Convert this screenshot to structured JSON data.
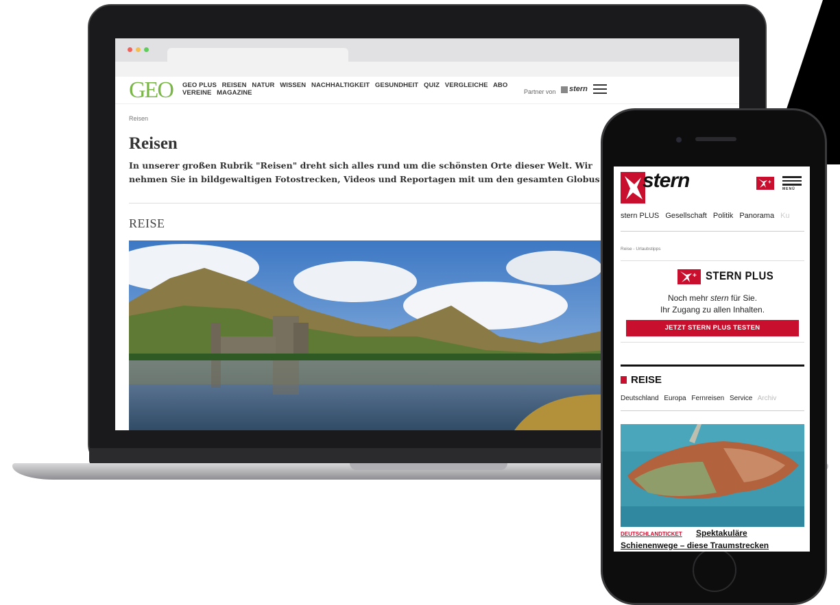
{
  "geo": {
    "logo": "GEO",
    "nav": [
      "GEO PLUS",
      "REISEN",
      "NATUR",
      "WISSEN",
      "NACHHALTIGKEIT",
      "GESUNDHEIT",
      "QUIZ",
      "VERGLEICHE",
      "ABO",
      "VEREINE",
      "MAGAZINE"
    ],
    "partner_label": "Partner von",
    "partner_brand": "stern",
    "breadcrumb": "Reisen",
    "title": "Reisen",
    "intro": "In unserer großen Rubrik \"Reisen\" dreht sich alles rund um die schönsten Orte dieser Welt. Wir nehmen Sie in bildgewaltigen Fotostrecken, Videos und Reportagen mit um den gesamten Globus",
    "section": "REISE",
    "brand_color": "#7ab648"
  },
  "stern": {
    "logo": "stern",
    "menu_label": "MENÜ",
    "nav": [
      "stern PLUS",
      "Gesellschaft",
      "Politik",
      "Panorama",
      "Ku"
    ],
    "breadcrumb": "Reise - Urlaubstipps",
    "plus_title": "STERN PLUS",
    "plus_line1_pre": "Noch mehr",
    "plus_line1_brand": "stern",
    "plus_line1_post": "für Sie.",
    "plus_line2": "Ihr Zugang zu allen Inhalten.",
    "plus_button": "JETZT STERN PLUS TESTEN",
    "section": "REISE",
    "subnav": [
      "Deutschland",
      "Europa",
      "Fernreisen",
      "Service",
      "Archiv"
    ],
    "article_kicker": "DEUTSCHLANDTICKET",
    "article_title_1": "Spektakuläre",
    "article_title_2": "Schienenwege – diese Traumstrecken",
    "brand_color": "#c8102e"
  }
}
